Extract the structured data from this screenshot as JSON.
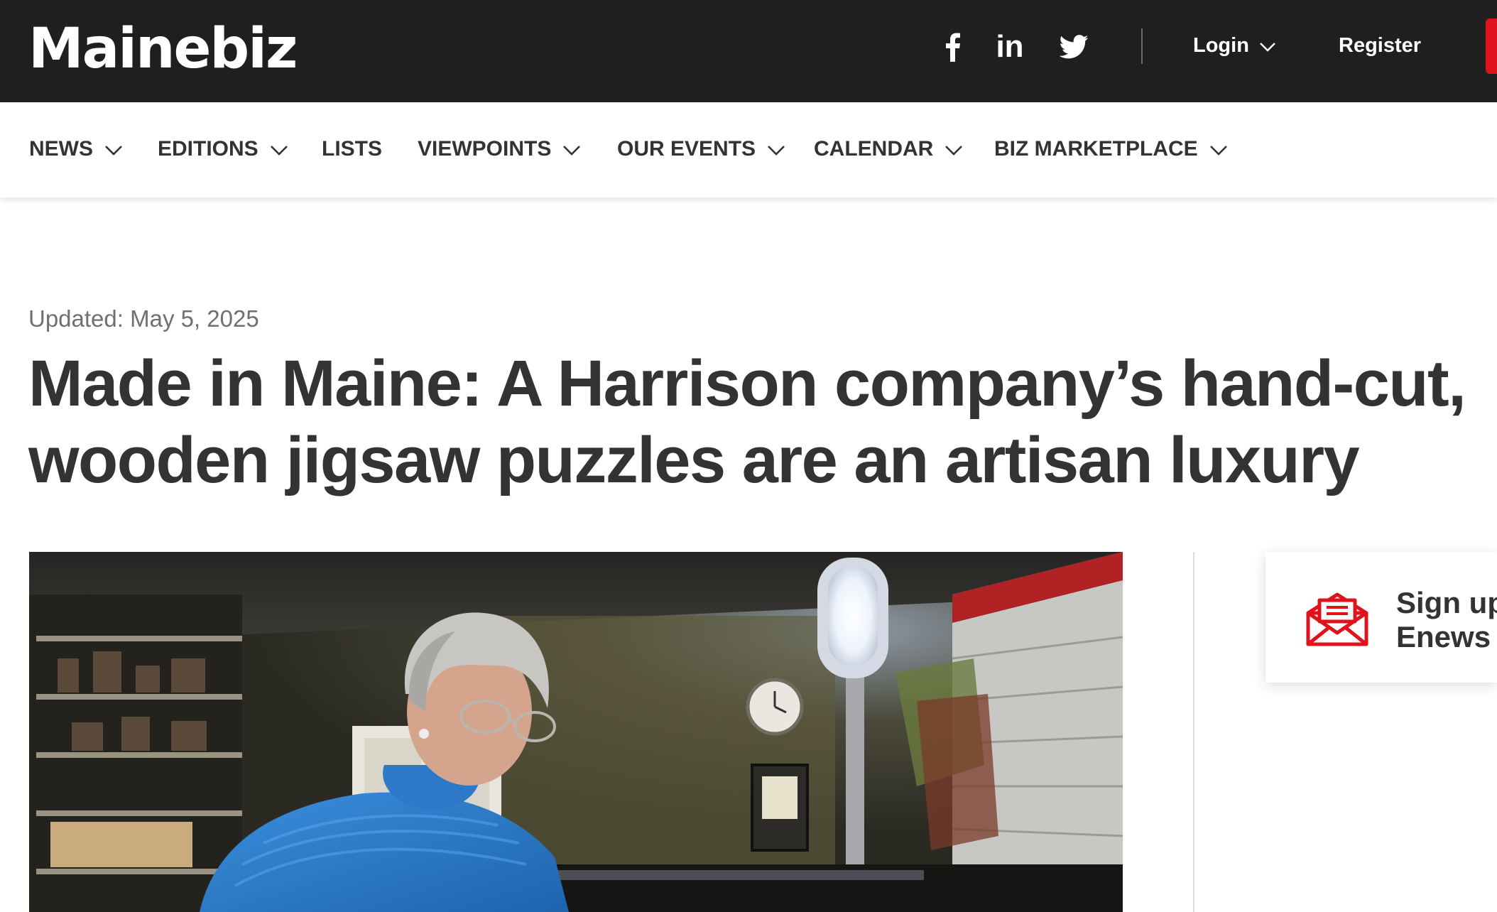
{
  "header": {
    "logo": "Mainebiz",
    "social": [
      "facebook-icon",
      "linkedin-icon",
      "twitter-icon"
    ],
    "linkedin_text": "in",
    "login_label": "Login",
    "register_label": "Register"
  },
  "nav": {
    "items": [
      {
        "label": "NEWS",
        "dropdown": true
      },
      {
        "label": "EDITIONS",
        "dropdown": true
      },
      {
        "label": "LISTS",
        "dropdown": false
      },
      {
        "label": "VIEWPOINTS",
        "dropdown": true
      },
      {
        "label": "OUR EVENTS",
        "dropdown": true
      },
      {
        "label": "CALENDAR",
        "dropdown": true
      },
      {
        "label": "BIZ MARKETPLACE",
        "dropdown": true
      }
    ]
  },
  "article": {
    "updated": "Updated: May 5, 2025",
    "headline_line1": "Made in Maine: A Harrison company’s hand-cut,",
    "headline_line2": "wooden jigsaw puzzles are an artisan luxury"
  },
  "sidebar": {
    "signup_line1": "Sign up",
    "signup_line2": "Enews"
  },
  "colors": {
    "topbar": "#1f1f1f",
    "accent_red": "#e0121b",
    "text_dark": "#333333",
    "text_muted": "#707070"
  }
}
